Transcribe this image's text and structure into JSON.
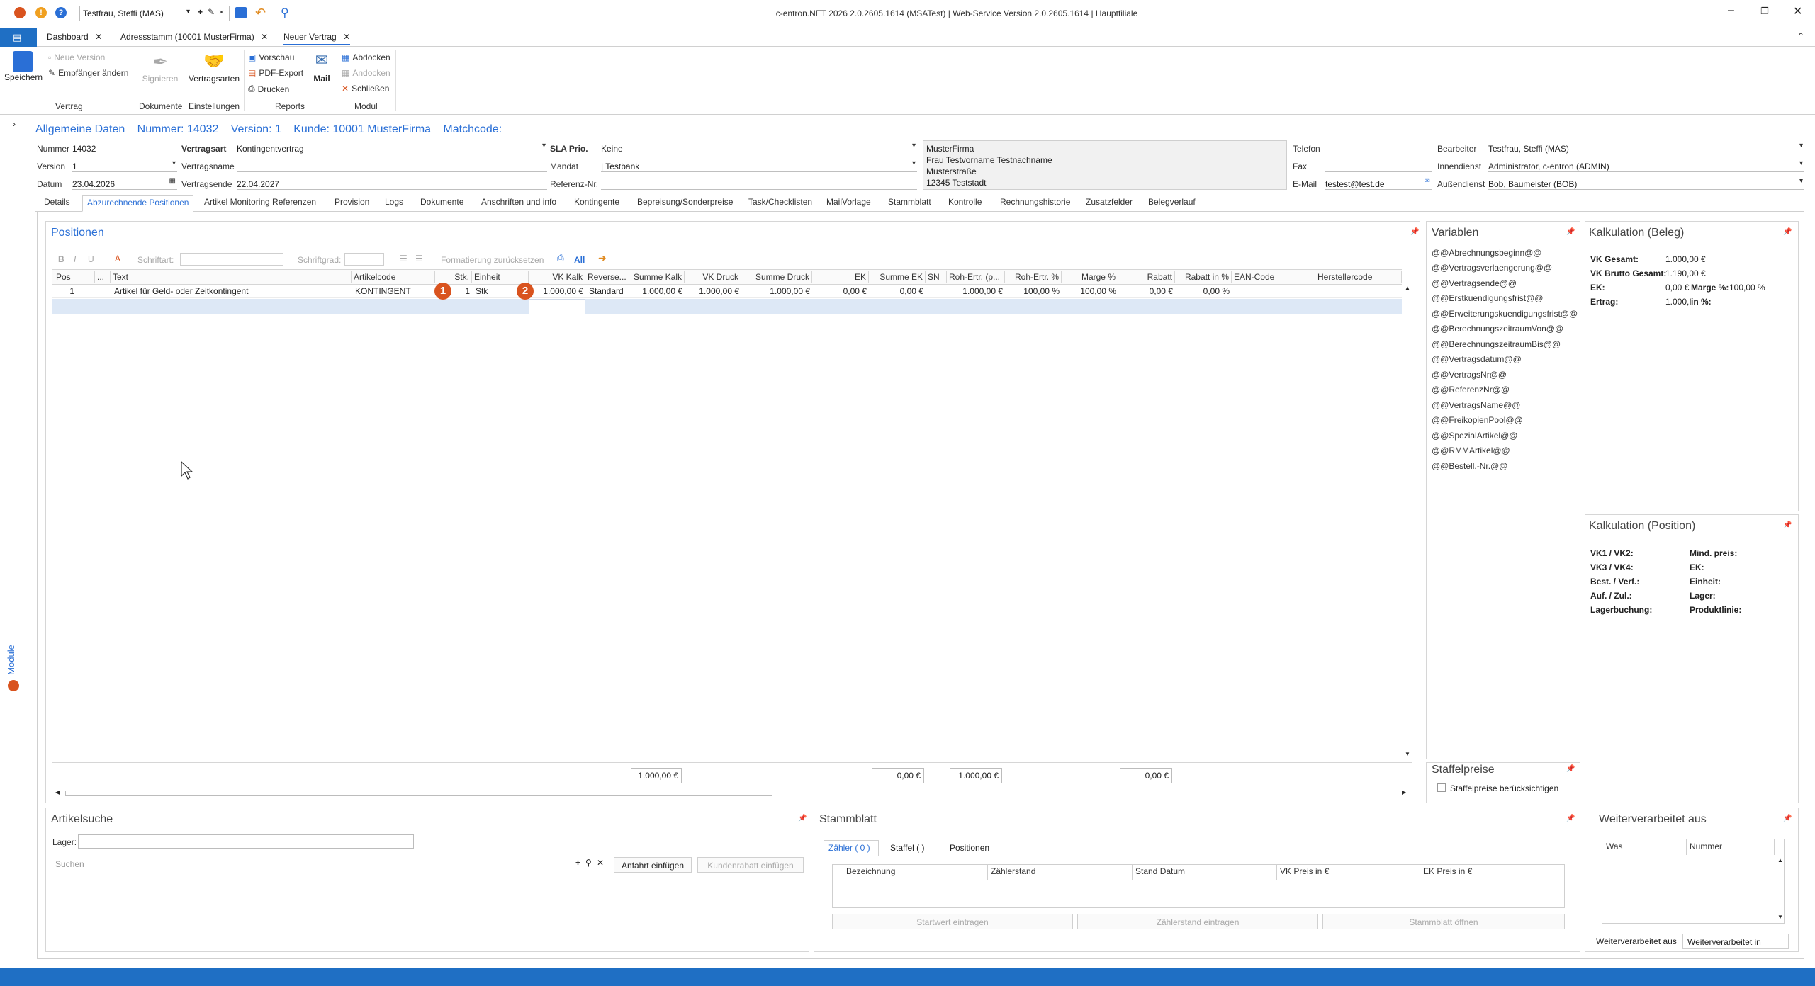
{
  "titlebar": {
    "user_select": "Testfrau, Steffi (MAS)",
    "title": "c-entron.NET 2026 2.0.2605.1614 (MSATest) | Web-Service Version 2.0.2605.1614 | Hauptfiliale"
  },
  "doc_tabs": [
    {
      "label": "Dashboard"
    },
    {
      "label": "Adressstamm (10001 MusterFirma)"
    },
    {
      "label": "Neuer Vertrag"
    }
  ],
  "ribbon": {
    "save": "Speichern",
    "neue_version": "Neue Version",
    "empfaenger": "Empfänger ändern",
    "group_vertrag": "Vertrag",
    "signieren": "Signieren",
    "group_dokumente": "Dokumente",
    "vertragsarten": "Vertragsarten",
    "group_einstellungen": "Einstellungen",
    "vorschau": "Vorschau",
    "pdf_export": "PDF-Export",
    "drucken": "Drucken",
    "mail": "Mail",
    "group_reports": "Reports",
    "abdocken": "Abdocken",
    "andocken": "Andocken",
    "schliessen": "Schließen",
    "group_modul": "Modul"
  },
  "side_module_label": "Module",
  "header": {
    "allgemeine": "Allgemeine Daten",
    "nummer": "Nummer: 14032",
    "version": "Version: 1",
    "kunde": "Kunde: 10001 MusterFirma",
    "matchcode": "Matchcode:"
  },
  "form": {
    "nummer_label": "Nummer",
    "nummer": "14032",
    "version_label": "Version",
    "version": "1",
    "datum_label": "Datum",
    "datum": "23.04.2026",
    "vertragsart_label": "Vertragsart",
    "vertragsart": "Kontingentvertrag",
    "vertragsname_label": "Vertragsname",
    "vertragsname": "",
    "vertragsende_label": "Vertragsende",
    "vertragsende": "22.04.2027",
    "sla_label": "SLA Prio.",
    "sla": "Keine",
    "mandat_label": "Mandat",
    "mandat": "| Testbank",
    "referenz_label": "Referenz-Nr.",
    "address": [
      "MusterFirma",
      "Frau Testvorname Testnachname",
      "Musterstraße",
      "12345 Teststadt"
    ],
    "telefon_label": "Telefon",
    "fax_label": "Fax",
    "email_label": "E-Mail",
    "email": "testest@test.de",
    "bearbeiter_label": "Bearbeiter",
    "bearbeiter": "Testfrau, Steffi (MAS)",
    "innendienst_label": "Innendienst",
    "innendienst": "Administrator, c-entron (ADMIN)",
    "aussendienst_label": "Außendienst",
    "aussendienst": "Bob, Baumeister (BOB)"
  },
  "section_tabs": [
    "Details",
    "Abzurechnende Positionen",
    "Artikel Monitoring Referenzen",
    "Provision",
    "Logs",
    "Dokumente",
    "Anschriften und info",
    "Kontingente",
    "Bepreisung/Sonderpreise",
    "Task/Checklisten",
    "MailVorlage",
    "Stammblatt",
    "Kontrolle",
    "Rechnungshistorie",
    "Zusatzfelder",
    "Belegverlauf"
  ],
  "positionen": {
    "title": "Positionen",
    "toolbar": {
      "schriftart": "Schriftart:",
      "schriftgrad": "Schriftgrad:",
      "reset": "Formatierung zurücksetzen",
      "all": "All"
    },
    "columns": [
      "Pos",
      "...",
      "Text",
      "Artikelcode",
      "Stk.",
      "Einheit",
      "VK Kalk",
      "Reverse...",
      "Summe Kalk",
      "VK Druck",
      "Summe Druck",
      "EK",
      "Summe EK",
      "SN",
      "Roh-Ertr. (p...",
      "Roh-Ertr. %",
      "Marge %",
      "Rabatt",
      "Rabatt in %",
      "EAN-Code",
      "Herstellercode"
    ],
    "row": {
      "pos": "1",
      "text": "Artikel für Geld- oder Zeitkontingent",
      "code": "KONTINGENT",
      "stk": "1",
      "einheit": "Stk",
      "vk_kalk": "1.000,00 €",
      "reverse": "Standard",
      "summe_kalk": "1.000,00 €",
      "vk_druck": "1.000,00 €",
      "summe_druck": "1.000,00 €",
      "ek": "0,00 €",
      "summe_ek": "0,00 €",
      "roh_p": "1.000,00 €",
      "roh_pct": "100,00 %",
      "marge": "100,00 %",
      "rabatt": "0,00 €",
      "rabatt_pct": "0,00 %"
    },
    "badges": [
      "1",
      "2"
    ],
    "totals": {
      "summe_kalk": "1.000,00 €",
      "summe_ek": "0,00 €",
      "roh": "1.000,00 €",
      "rabatt": "0,00 €"
    }
  },
  "variablen": {
    "title": "Variablen",
    "items": [
      "@@Abrechnungsbeginn@@",
      "@@Vertragsverlaengerung@@",
      "@@Vertragsende@@",
      "@@Erstkuendigungsfrist@@",
      "@@Erweiterungskuendigungsfrist@@",
      "@@BerechnungszeitraumVon@@",
      "@@BerechnungszeitraumBis@@",
      "@@Vertragsdatum@@",
      "@@VertragsNr@@",
      "@@ReferenzNr@@",
      "@@VertragsName@@",
      "@@FreikopienPool@@",
      "@@SpezialArtikel@@",
      "@@RMMArtikel@@",
      "@@Bestell.-Nr.@@"
    ]
  },
  "kalk_beleg": {
    "title": "Kalkulation (Beleg)",
    "vk_gesamt_label": "VK Gesamt:",
    "vk_gesamt": "1.000,00 €",
    "vk_brutto_label": "VK Brutto Gesamt:",
    "vk_brutto": "1.190,00 €",
    "ek_label": "EK:",
    "ek": "0,00 €",
    "marge_label": "Marge %:",
    "marge": "100,00 %",
    "ertrag_label": "Ertrag:",
    "ertrag": "1.000,I",
    "in_pct_label": "in %:"
  },
  "kalk_pos": {
    "title": "Kalkulation (Position)",
    "left": [
      "VK1 / VK2:",
      "VK3 / VK4:",
      "Best. / Verf.:",
      "Auf. / Zul.:",
      "Lagerbuchung:"
    ],
    "right": [
      "Mind. preis:",
      "EK:",
      "Einheit:",
      "Lager:",
      "Produktlinie:"
    ]
  },
  "staffelpreise": {
    "title": "Staffelpreise",
    "checkbox": "Staffelpreise berücksichtigen"
  },
  "artikelsuche": {
    "title": "Artikelsuche",
    "lager_label": "Lager:",
    "search_placeholder": "Suchen",
    "anfahrt": "Anfahrt einfügen",
    "kundenrabatt": "Kundenrabatt einfügen"
  },
  "stammblatt": {
    "title": "Stammblatt",
    "tabs": [
      "Zähler ( 0 )",
      "Staffel ( )",
      "Positionen"
    ],
    "columns": [
      "Bezeichnung",
      "Zählerstand",
      "Stand Datum",
      "VK Preis in €",
      "EK Preis in €"
    ],
    "buttons": [
      "Startwert eintragen",
      "Zählerstand eintragen",
      "Stammblatt öffnen"
    ]
  },
  "weiterverarbeitet": {
    "title": "Weiterverarbeitet aus",
    "columns": [
      "Was",
      "Nummer"
    ],
    "tabs": [
      "Weiterverarbeitet aus",
      "Weiterverarbeitet in"
    ]
  },
  "colors": {
    "accent": "#2a6fd6",
    "statusbar": "#1f6fc4",
    "badge": "#d9531e"
  }
}
